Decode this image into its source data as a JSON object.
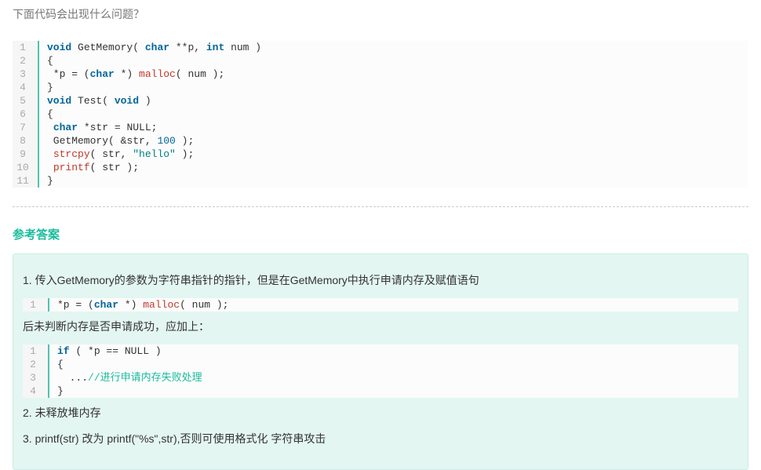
{
  "question": "下面代码会出现什么问题？",
  "code1": [
    [
      [
        "kw",
        "void"
      ],
      [
        "",
        " GetMemory( "
      ],
      [
        "kw",
        "char"
      ],
      [
        "",
        " **p, "
      ],
      [
        "kw",
        "int"
      ],
      [
        "",
        " num )"
      ]
    ],
    [
      [
        "",
        "{"
      ]
    ],
    [
      [
        "",
        " *p = ("
      ],
      [
        "kw",
        "char"
      ],
      [
        "",
        " *) "
      ],
      [
        "fn",
        "malloc"
      ],
      [
        "",
        "( num );"
      ]
    ],
    [
      [
        "",
        "}"
      ]
    ],
    [
      [
        "kw",
        "void"
      ],
      [
        "",
        " Test( "
      ],
      [
        "kw",
        "void"
      ],
      [
        "",
        " )"
      ]
    ],
    [
      [
        "",
        "{"
      ]
    ],
    [
      [
        "",
        " "
      ],
      [
        "kw",
        "char"
      ],
      [
        "",
        " *str = NULL;"
      ]
    ],
    [
      [
        "",
        " GetMemory( &str, "
      ],
      [
        "num",
        "100"
      ],
      [
        "",
        " );"
      ]
    ],
    [
      [
        "",
        " "
      ],
      [
        "fn",
        "strcpy"
      ],
      [
        "",
        "( str, "
      ],
      [
        "str",
        "\"hello\""
      ],
      [
        "",
        " );"
      ]
    ],
    [
      [
        "",
        " "
      ],
      [
        "fn",
        "printf"
      ],
      [
        "",
        "( str );"
      ]
    ],
    [
      [
        "",
        "}"
      ]
    ]
  ],
  "answer_title": "参考答案",
  "a1": "1. 传入GetMemory的参数为字符串指针的指针，但是在GetMemory中执行申请内存及赋值语句",
  "code2": [
    [
      [
        "",
        "*p = ("
      ],
      [
        "kw",
        "char"
      ],
      [
        "",
        " *) "
      ],
      [
        "fn",
        "malloc"
      ],
      [
        "",
        "( num );"
      ]
    ]
  ],
  "a2": "后未判断内存是否申请成功，应加上：",
  "code3": [
    [
      [
        "kw",
        "if"
      ],
      [
        "",
        " ( *p == NULL )"
      ]
    ],
    [
      [
        "",
        "{"
      ]
    ],
    [
      [
        "",
        "  ..."
      ],
      [
        "cmt",
        "//进行申请内存失败处理"
      ]
    ],
    [
      [
        "",
        "}"
      ]
    ]
  ],
  "a3": "2. 未释放堆内存",
  "a4": "3. printf(str) 改为 printf(\"%s\",str),否则可使用格式化 字符串攻击"
}
